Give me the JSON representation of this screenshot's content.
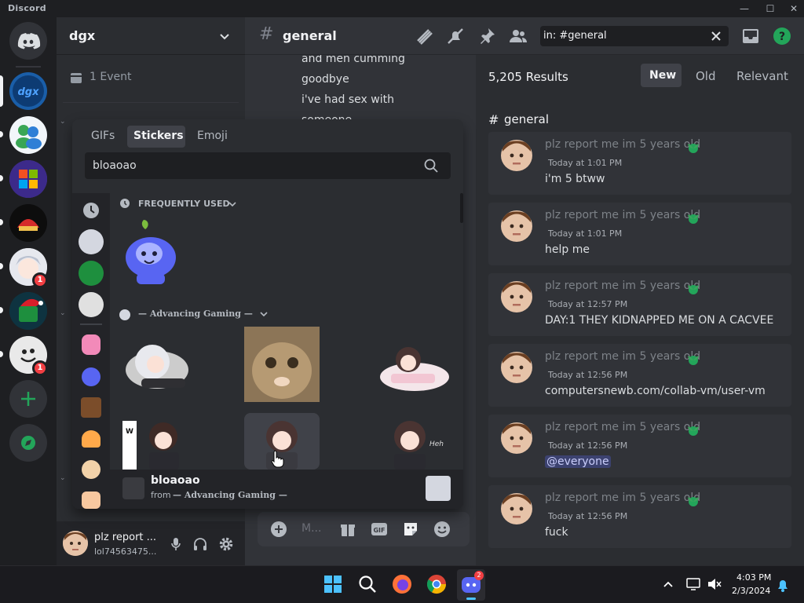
{
  "app": {
    "title": "Discord"
  },
  "window_controls": {
    "minimize": "—",
    "maximize": "☐",
    "close": "✕"
  },
  "server": {
    "name": "dgx",
    "event_label": "1 Event"
  },
  "guild_badges": {
    "g5": "1",
    "g7": "1"
  },
  "channel": {
    "name": "general",
    "hash": "#"
  },
  "chat_preview": [
    "and men cumming",
    "goodbye",
    "i've had sex with",
    "someone"
  ],
  "search": {
    "query": "in: #general",
    "results_count": "5,205 Results",
    "sort_options": [
      "New",
      "Old",
      "Relevant"
    ],
    "active_sort": "New",
    "channel_label": "general"
  },
  "results": [
    {
      "author": "plz report me im 5 years old",
      "time": "Today at 1:01 PM",
      "text": "i'm 5 btww"
    },
    {
      "author": "plz report me im 5 years old",
      "time": "Today at 1:01 PM",
      "text": "help me"
    },
    {
      "author": "plz report me im 5 years old",
      "time": "Today at 12:57 PM",
      "text": "DAY:1 THEY KIDNAPPED ME ON A CACVEE"
    },
    {
      "author": "plz report me im 5 years old",
      "time": "Today at 12:56 PM",
      "text": "computersnewb.com/collab-vm/user-vm"
    },
    {
      "author": "plz report me im 5 years old",
      "time": "Today at 12:56 PM",
      "text": "@everyone"
    },
    {
      "author": "plz report me im 5 years old",
      "time": "Today at 12:56 PM",
      "text": "fuck"
    }
  ],
  "picker": {
    "tabs": [
      "GIFs",
      "Stickers",
      "Emoji"
    ],
    "active_tab": "Stickers",
    "search_value": "bloaoao",
    "section_frequent": "FREQUENTLY USED",
    "section_server": "— Advancing Gaming —",
    "preview_name": "bloaoao",
    "preview_from": "from",
    "preview_server": "— Advancing Gaming —",
    "sticker_text": "WHAT's up"
  },
  "composer": {
    "placeholder": "M..."
  },
  "user": {
    "name": "plz report ...",
    "tag": "lol74563475..."
  },
  "taskbar": {
    "time": "4:03 PM",
    "date": "2/3/2024",
    "discord_badge": "2"
  },
  "colors": {
    "accent": "#5865f2",
    "green": "#23a55a",
    "red": "#f23f43",
    "mention_bg": "#3c4270"
  }
}
